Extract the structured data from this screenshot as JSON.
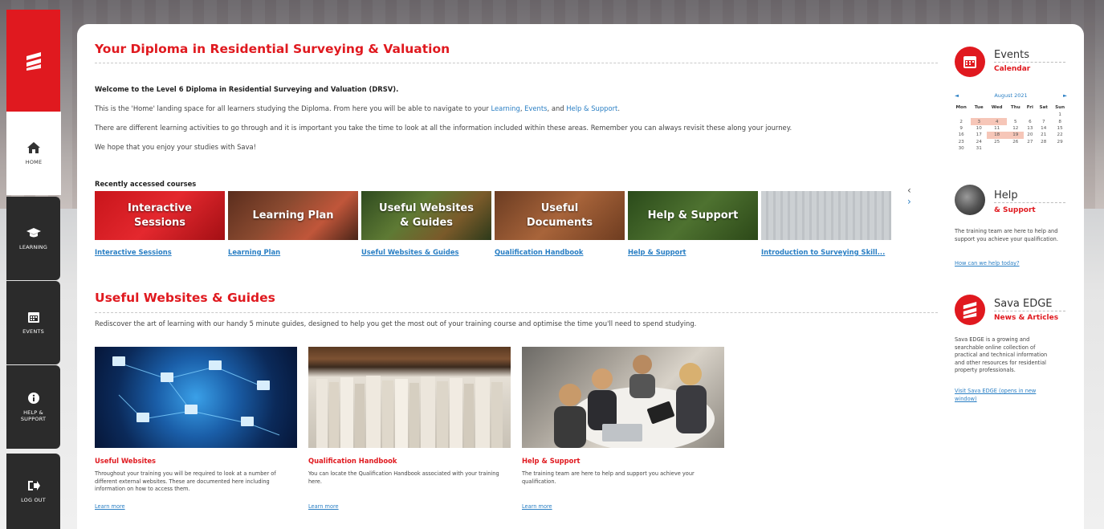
{
  "sidebar": {
    "logo_alt": "Sava",
    "items": [
      {
        "label": "HOME",
        "icon": "home-icon",
        "active": true
      },
      {
        "label": "LEARNING",
        "icon": "graduation-cap-icon",
        "active": false
      },
      {
        "label": "EVENTS",
        "icon": "calendar-icon",
        "active": false
      },
      {
        "label": "HELP & SUPPORT",
        "icon": "info-icon",
        "active": false
      },
      {
        "label": "LOG OUT",
        "icon": "logout-icon",
        "active": false
      }
    ]
  },
  "main": {
    "title": "Your Diploma in Residential Surveying & Valuation",
    "welcome": "Welcome to the Level 6 Diploma in Residential Surveying and Valuation (DRSV).",
    "para1_prefix": "This is the 'Home' landing space for all learners studying the Diploma. From here you will be able to navigate to your ",
    "para1_link1": "Learning",
    "para1_sep1": ", ",
    "para1_link2": "Events",
    "para1_sep2": ", and ",
    "para1_link3": "Help & Support",
    "para1_suffix": ".",
    "para2": "There are different learning activities to go through and it is important you take the time to look at all the information included within these areas. Remember you can always revisit these along your journey.",
    "para3": "We hope that you enjoy your studies with Sava!",
    "recent_heading": "Recently accessed courses",
    "prev_arrow": "‹",
    "next_arrow": "›",
    "courses": [
      {
        "tile_text": "Interactive Sessions",
        "label": "Interactive Sessions"
      },
      {
        "tile_text": "Learning Plan",
        "label": "Learning Plan"
      },
      {
        "tile_text": "Useful Websites & Guides",
        "label": "Useful Websites & Guides"
      },
      {
        "tile_text": "Useful Documents",
        "label": "Qualification Handbook"
      },
      {
        "tile_text": "Help & Support",
        "label": "Help & Support"
      },
      {
        "tile_text": "",
        "label": "Introduction to Surveying Skill..."
      }
    ]
  },
  "guides": {
    "title": "Useful Websites & Guides",
    "intro": "Rediscover the art of learning with our handy 5 minute guides, designed to help you get the most out of your training course and optimise the time you'll need to spend studying.",
    "items": [
      {
        "title": "Useful Websites",
        "desc": "Throughout your training you will be required to look at a number of different external websites. These are documented here including information on how to access them.",
        "link": "Learn more"
      },
      {
        "title": "Qualification Handbook",
        "desc": "You can locate the Qualification Handbook associated with your training here.",
        "link": "Learn more"
      },
      {
        "title": "Help & Support",
        "desc": "The training team are here to help and support you achieve your qualification.",
        "link": "Learn more"
      }
    ]
  },
  "right": {
    "events": {
      "title": "Events",
      "subtitle": "Calendar",
      "month": "August 2021",
      "prev": "◄",
      "next": "►",
      "weekdays": [
        "Mon",
        "Tue",
        "Wed",
        "Thu",
        "Fri",
        "Sat",
        "Sun"
      ],
      "weeks": [
        [
          "",
          "",
          "",
          "",
          "",
          "",
          "1"
        ],
        [
          "2",
          "3",
          "4",
          "5",
          "6",
          "7",
          "8"
        ],
        [
          "9",
          "10",
          "11",
          "12",
          "13",
          "14",
          "15"
        ],
        [
          "16",
          "17",
          "18",
          "19",
          "20",
          "21",
          "22"
        ],
        [
          "23",
          "24",
          "25",
          "26",
          "27",
          "28",
          "29"
        ],
        [
          "30",
          "31",
          "",
          "",
          "",
          "",
          ""
        ]
      ],
      "highlighted_days": [
        "3",
        "4",
        "18",
        "19"
      ],
      "highlight_color": "#f6c6b8"
    },
    "help": {
      "title": "Help",
      "subtitle": "& Support",
      "text": "The training team are here to help and support you achieve your qualification.",
      "link": "How can we help today?"
    },
    "edge": {
      "title": "Sava EDGE",
      "subtitle": "News & Articles",
      "text": "Sava EDGE is a growing and searchable online collection of practical and technical information and other resources for residential property professionals.",
      "link": "Visit Sava EDGE (opens in new window)"
    }
  },
  "colors": {
    "brand_red": "#e0191f",
    "link_blue": "#2a7fc4",
    "sidebar_dark": "#2b2b2b"
  }
}
